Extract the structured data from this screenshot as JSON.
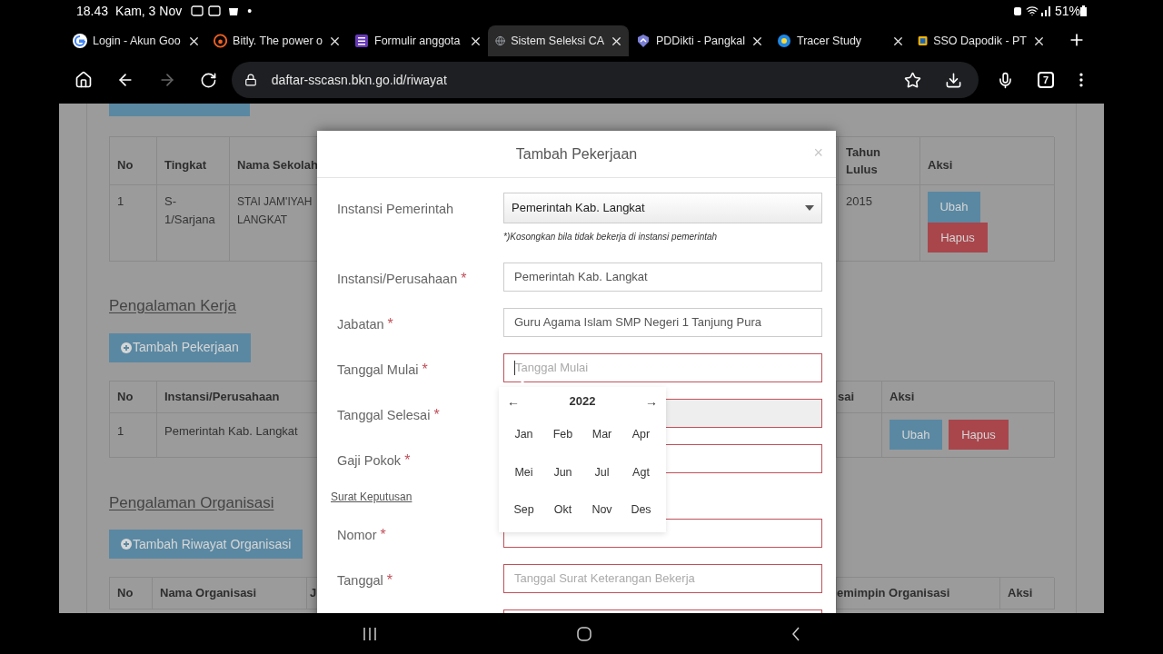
{
  "status_bar": {
    "time": "18.43",
    "date": "Kam, 3 Nov",
    "dot": "•",
    "battery": "51%"
  },
  "browser_tabs": [
    {
      "title": "Login - Akun Goo",
      "selected": false
    },
    {
      "title": "Bitly. The power o",
      "selected": false
    },
    {
      "title": "Formulir anggota",
      "selected": false
    },
    {
      "title": "Sistem Seleksi CA",
      "selected": true
    },
    {
      "title": "PDDikti - Pangkal",
      "selected": false
    },
    {
      "title": "Tracer Study",
      "selected": false
    },
    {
      "title": "SSO Dapodik - PT",
      "selected": false
    }
  ],
  "address_bar": {
    "url": "daftar-sscasn.bkn.go.id/riwayat",
    "tab_count": "7",
    "forward_disabled": true
  },
  "page": {
    "education_table": {
      "columns": [
        "No",
        "Tingkat",
        "Nama Sekolah",
        "Tahun Lulus",
        "Aksi"
      ],
      "rows": [
        {
          "no": "1",
          "level": "S-1/Sarjana",
          "school": "STAI JAM'IYAH LANGKAT",
          "year": "2015",
          "edit": "Ubah",
          "delete": "Hapus"
        }
      ]
    },
    "work_section": {
      "heading": "Pengalaman Kerja",
      "add_button": "Tambah Pekerjaan",
      "columns": [
        "No",
        "Instansi/Perusahaan",
        "sai",
        "Aksi"
      ],
      "rows": [
        {
          "no": "1",
          "company": "Pemerintah Kab. Langkat",
          "edit": "Ubah",
          "delete": "Hapus"
        }
      ]
    },
    "org_section": {
      "heading": "Pengalaman Organisasi",
      "add_button": "Tambah Riwayat Organisasi",
      "columns": [
        "No",
        "Nama Organisasi",
        "J",
        "emimpin Organisasi",
        "Aksi"
      ]
    }
  },
  "modal": {
    "title": "Tambah Pekerjaan",
    "close": "×",
    "required_mark": "*",
    "fields": [
      {
        "kind": "select",
        "label": "Instansi Pemerintah",
        "required": false,
        "value": "Pemerintah Kab. Langkat",
        "hint": "*)Kosongkan bila tidak bekerja di instansi pemerintah"
      },
      {
        "kind": "text",
        "label": "Instansi/Perusahaan",
        "required": true,
        "value": "Pemerintah Kab. Langkat",
        "invalid": false,
        "disabled": false
      },
      {
        "kind": "text",
        "label": "Jabatan",
        "required": true,
        "value": "Guru Agama Islam SMP Negeri 1 Tanjung Pura",
        "invalid": false,
        "disabled": false
      },
      {
        "kind": "text",
        "label": "Tanggal Mulai",
        "required": true,
        "placeholder": "Tanggal Mulai",
        "invalid": true,
        "disabled": false,
        "focused": true
      },
      {
        "kind": "text",
        "label": "Tanggal Selesai",
        "required": true,
        "invalid": true,
        "disabled": true
      },
      {
        "kind": "text",
        "label": "Gaji Pokok",
        "required": true,
        "invalid": true,
        "disabled": false
      },
      {
        "kind": "section",
        "label": "Surat Keputusan"
      },
      {
        "kind": "text",
        "label": "Nomor",
        "required": true,
        "invalid": true,
        "disabled": false
      },
      {
        "kind": "text",
        "label": "Tanggal",
        "required": true,
        "placeholder": "Tanggal Surat Keterangan Bekerja",
        "invalid": true,
        "disabled": false
      },
      {
        "kind": "text",
        "invalid": true,
        "disabled": false
      }
    ],
    "datepicker": {
      "prev": "←",
      "year": "2022",
      "next": "→",
      "months": [
        "Jan",
        "Feb",
        "Mar",
        "Apr",
        "Mei",
        "Jun",
        "Jul",
        "Agt",
        "Sep",
        "Okt",
        "Nov",
        "Des"
      ]
    }
  }
}
